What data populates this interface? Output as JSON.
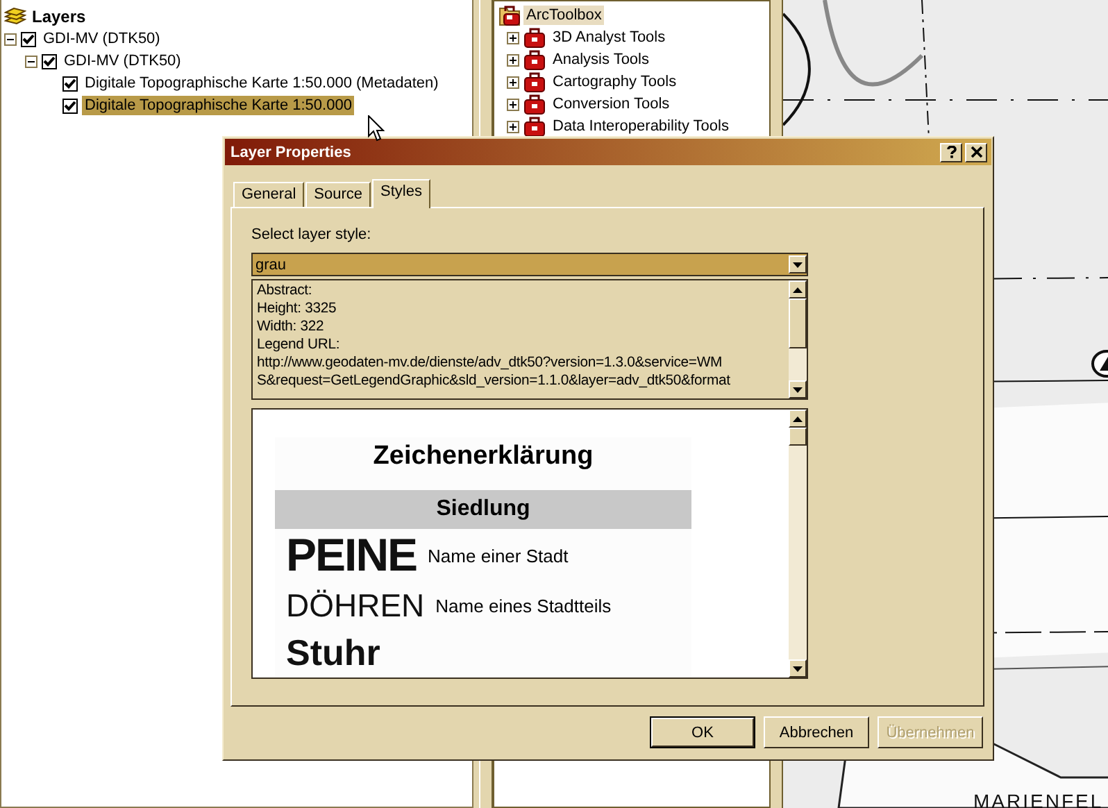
{
  "layers_panel": {
    "title": "Layers",
    "tree": [
      {
        "label": "GDI-MV (DTK50)",
        "checked": true,
        "expanded": true,
        "selected": false,
        "children": [
          {
            "label": "GDI-MV (DTK50)",
            "checked": true,
            "expanded": true,
            "selected": false,
            "children": [
              {
                "label": "Digitale Topographische Karte 1:50.000 (Metadaten)",
                "checked": true,
                "selected": false
              },
              {
                "label": "Digitale Topographische Karte 1:50.000",
                "checked": true,
                "selected": true
              }
            ]
          }
        ]
      }
    ]
  },
  "toolbox": {
    "root": {
      "label": "ArcToolbox",
      "selected": true
    },
    "items": [
      {
        "label": "3D Analyst Tools",
        "expanded": false
      },
      {
        "label": "Analysis Tools",
        "expanded": false
      },
      {
        "label": "Cartography Tools",
        "expanded": false
      },
      {
        "label": "Conversion Tools",
        "expanded": false
      },
      {
        "label": "Data Interoperability Tools",
        "expanded": false
      }
    ]
  },
  "map": {
    "label": "MARIENFEL"
  },
  "dialog": {
    "title": "Layer Properties",
    "tabs": [
      {
        "label": "General",
        "selected": false
      },
      {
        "label": "Source",
        "selected": false
      },
      {
        "label": "Styles",
        "selected": true
      }
    ],
    "style_label": "Select layer style:",
    "style_value": "grau",
    "abstract_lines": [
      "Abstract:",
      "Height: 3325",
      "Width: 322",
      "Legend URL:",
      "http://www.geodaten-mv.de/dienste/adv_dtk50?version=1.3.0&service=WM",
      "S&request=GetLegendGraphic&sld_version=1.1.0&layer=adv_dtk50&format"
    ],
    "legend": {
      "title": "Zeichenerklärung",
      "section": "Siedlung",
      "rows": [
        {
          "kind": "city",
          "sample": "PEINE",
          "description": "Name einer Stadt"
        },
        {
          "kind": "district",
          "sample": "DÖHREN",
          "description": "Name eines Stadtteils"
        },
        {
          "kind": "municipality",
          "sample": "Stuhr"
        }
      ]
    },
    "buttons": [
      {
        "label": "OK",
        "default": true,
        "disabled": false
      },
      {
        "label": "Abbrechen",
        "default": false,
        "disabled": false
      },
      {
        "label": "Übernehmen",
        "default": false,
        "disabled": true
      }
    ]
  }
}
